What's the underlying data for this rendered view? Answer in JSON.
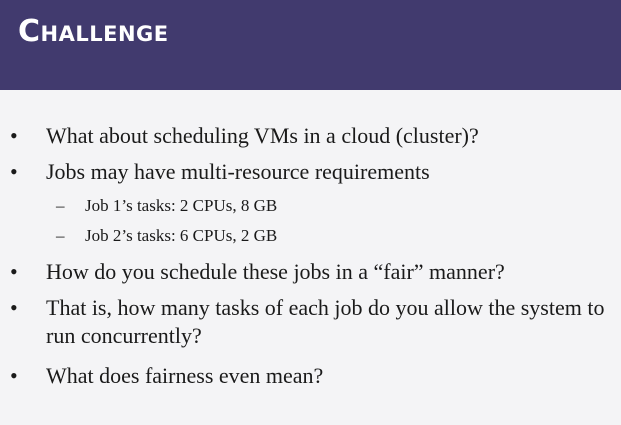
{
  "header": {
    "title": "Challenge",
    "background": "#413a6e"
  },
  "bullets": [
    {
      "marker": "•",
      "text": "What about scheduling VMs in a cloud (cluster)?"
    },
    {
      "marker": "•",
      "text": "Jobs may have multi-resource requirements"
    },
    {
      "marker": "–",
      "text": "Job 1’s tasks: 2 CPUs, 8 GB"
    },
    {
      "marker": "–",
      "text": "Job 2’s tasks: 6 CPUs, 2 GB"
    },
    {
      "marker": "•",
      "text": "How do you schedule these jobs in a “fair” manner?"
    },
    {
      "marker": "•",
      "text": "That is, how many tasks of each job do you allow the system to run concurrently?"
    },
    {
      "marker": "•",
      "text": "What does fairness even mean?"
    }
  ]
}
